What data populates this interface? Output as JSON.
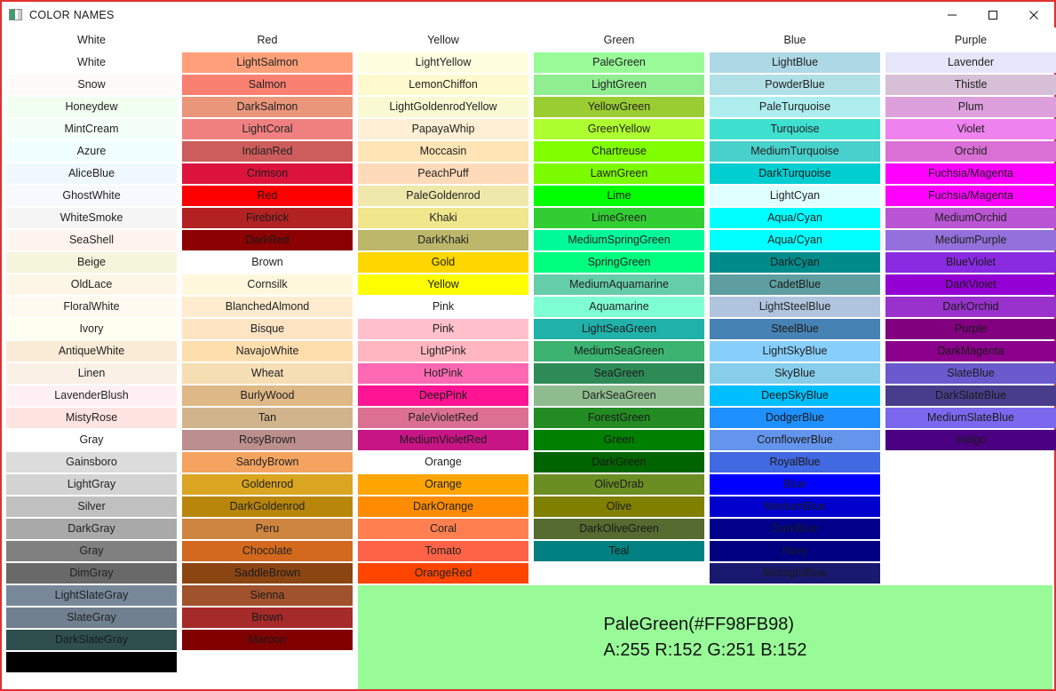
{
  "window": {
    "title": "COLOR NAMES",
    "icon": "app-color-icon",
    "border_color": "#e03030",
    "minimize_label": "—",
    "maximize_label": "□",
    "close_label": "✕"
  },
  "columns": [
    {
      "header": "White",
      "swatches": [
        {
          "name": "White",
          "bg": "#FFFFFF",
          "fg": "#222222"
        },
        {
          "name": "Snow",
          "bg": "#FFFAFA",
          "fg": "#222222"
        },
        {
          "name": "Honeydew",
          "bg": "#F0FFF0",
          "fg": "#222222"
        },
        {
          "name": "MintCream",
          "bg": "#F5FFFA",
          "fg": "#222222"
        },
        {
          "name": "Azure",
          "bg": "#F0FFFF",
          "fg": "#222222"
        },
        {
          "name": "AliceBlue",
          "bg": "#F0F8FF",
          "fg": "#222222"
        },
        {
          "name": "GhostWhite",
          "bg": "#F8F8FF",
          "fg": "#222222"
        },
        {
          "name": "WhiteSmoke",
          "bg": "#F5F5F5",
          "fg": "#222222"
        },
        {
          "name": "SeaShell",
          "bg": "#FFF5EE",
          "fg": "#222222"
        },
        {
          "name": "Beige",
          "bg": "#F5F5DC",
          "fg": "#222222"
        },
        {
          "name": "OldLace",
          "bg": "#FDF5E6",
          "fg": "#222222"
        },
        {
          "name": "FloralWhite",
          "bg": "#FFFAF0",
          "fg": "#222222"
        },
        {
          "name": "Ivory",
          "bg": "#FFFFF0",
          "fg": "#222222"
        },
        {
          "name": "AntiqueWhite",
          "bg": "#FAEBD7",
          "fg": "#222222"
        },
        {
          "name": "Linen",
          "bg": "#FAF0E6",
          "fg": "#222222"
        },
        {
          "name": "LavenderBlush",
          "bg": "#FFF0F5",
          "fg": "#222222"
        },
        {
          "name": "MistyRose",
          "bg": "#FFE4E1",
          "fg": "#222222"
        },
        {
          "name": "Gray",
          "bg": "#FFFFFF",
          "fg": "#222222",
          "group": true
        },
        {
          "name": "Gainsboro",
          "bg": "#DCDCDC",
          "fg": "#222222"
        },
        {
          "name": "LightGray",
          "bg": "#D3D3D3",
          "fg": "#222222"
        },
        {
          "name": "Silver",
          "bg": "#C0C0C0",
          "fg": "#222222"
        },
        {
          "name": "DarkGray",
          "bg": "#A9A9A9",
          "fg": "#222222"
        },
        {
          "name": "Gray",
          "bg": "#808080",
          "fg": "#222222"
        },
        {
          "name": "DimGray",
          "bg": "#696969",
          "fg": "#222222"
        },
        {
          "name": "LightSlateGray",
          "bg": "#778899",
          "fg": "#222222"
        },
        {
          "name": "SlateGray",
          "bg": "#708090",
          "fg": "#222222"
        },
        {
          "name": "DarkSlateGray",
          "bg": "#2F4F4F",
          "fg": "#1a1a1a"
        },
        {
          "name": "",
          "bg": "#000000",
          "fg": "#000000"
        }
      ]
    },
    {
      "header": "Red",
      "swatches": [
        {
          "name": "LightSalmon",
          "bg": "#FFA07A",
          "fg": "#222222"
        },
        {
          "name": "Salmon",
          "bg": "#FA8072",
          "fg": "#222222"
        },
        {
          "name": "DarkSalmon",
          "bg": "#E9967A",
          "fg": "#222222"
        },
        {
          "name": "LightCoral",
          "bg": "#F08080",
          "fg": "#222222"
        },
        {
          "name": "IndianRed",
          "bg": "#CD5C5C",
          "fg": "#222222"
        },
        {
          "name": "Crimson",
          "bg": "#DC143C",
          "fg": "#1a1a1a"
        },
        {
          "name": "Red",
          "bg": "#FF0000",
          "fg": "#1a1a1a"
        },
        {
          "name": "Firebrick",
          "bg": "#B22222",
          "fg": "#1a1a1a"
        },
        {
          "name": "DarkRed",
          "bg": "#8B0000",
          "fg": "#1a1a1a"
        },
        {
          "name": "Brown",
          "bg": "#FFFFFF",
          "fg": "#222222",
          "group": true
        },
        {
          "name": "Cornsilk",
          "bg": "#FFF8DC",
          "fg": "#222222"
        },
        {
          "name": "BlanchedAlmond",
          "bg": "#FFEBCD",
          "fg": "#222222"
        },
        {
          "name": "Bisque",
          "bg": "#FFE4C4",
          "fg": "#222222"
        },
        {
          "name": "NavajoWhite",
          "bg": "#FFDEAD",
          "fg": "#222222"
        },
        {
          "name": "Wheat",
          "bg": "#F5DEB3",
          "fg": "#222222"
        },
        {
          "name": "BurlyWood",
          "bg": "#DEB887",
          "fg": "#222222"
        },
        {
          "name": "Tan",
          "bg": "#D2B48C",
          "fg": "#222222"
        },
        {
          "name": "RosyBrown",
          "bg": "#BC8F8F",
          "fg": "#222222"
        },
        {
          "name": "SandyBrown",
          "bg": "#F4A460",
          "fg": "#222222"
        },
        {
          "name": "Goldenrod",
          "bg": "#DAA520",
          "fg": "#222222"
        },
        {
          "name": "DarkGoldenrod",
          "bg": "#B8860B",
          "fg": "#222222"
        },
        {
          "name": "Peru",
          "bg": "#CD853F",
          "fg": "#222222"
        },
        {
          "name": "Chocolate",
          "bg": "#D2691E",
          "fg": "#222222"
        },
        {
          "name": "SaddleBrown",
          "bg": "#8B4513",
          "fg": "#1a1a1a"
        },
        {
          "name": "Sienna",
          "bg": "#A0522D",
          "fg": "#1a1a1a"
        },
        {
          "name": "Brown",
          "bg": "#A52A2A",
          "fg": "#1a1a1a"
        },
        {
          "name": "Maroon",
          "bg": "#800000",
          "fg": "#1a1a1a"
        }
      ]
    },
    {
      "header": "Yellow",
      "swatches": [
        {
          "name": "LightYellow",
          "bg": "#FFFFE0",
          "fg": "#222222"
        },
        {
          "name": "LemonChiffon",
          "bg": "#FFFACD",
          "fg": "#222222"
        },
        {
          "name": "LightGoldenrodYellow",
          "bg": "#FAFAD2",
          "fg": "#222222"
        },
        {
          "name": "PapayaWhip",
          "bg": "#FFEFD5",
          "fg": "#222222"
        },
        {
          "name": "Moccasin",
          "bg": "#FFE4B5",
          "fg": "#222222"
        },
        {
          "name": "PeachPuff",
          "bg": "#FFDAB9",
          "fg": "#222222"
        },
        {
          "name": "PaleGoldenrod",
          "bg": "#EEE8AA",
          "fg": "#222222"
        },
        {
          "name": "Khaki",
          "bg": "#F0E68C",
          "fg": "#222222"
        },
        {
          "name": "DarkKhaki",
          "bg": "#BDB76B",
          "fg": "#222222"
        },
        {
          "name": "Gold",
          "bg": "#FFD700",
          "fg": "#222222"
        },
        {
          "name": "Yellow",
          "bg": "#FFFF00",
          "fg": "#222222"
        },
        {
          "name": "Pink",
          "bg": "#FFFFFF",
          "fg": "#222222",
          "group": true
        },
        {
          "name": "Pink",
          "bg": "#FFC0CB",
          "fg": "#222222"
        },
        {
          "name": "LightPink",
          "bg": "#FFB6C1",
          "fg": "#222222"
        },
        {
          "name": "HotPink",
          "bg": "#FF69B4",
          "fg": "#222222"
        },
        {
          "name": "DeepPink",
          "bg": "#FF1493",
          "fg": "#1a1a1a"
        },
        {
          "name": "PaleVioletRed",
          "bg": "#DB7093",
          "fg": "#222222"
        },
        {
          "name": "MediumVioletRed",
          "bg": "#C71585",
          "fg": "#1a1a1a"
        },
        {
          "name": "Orange",
          "bg": "#FFFFFF",
          "fg": "#222222",
          "group": true
        },
        {
          "name": "Orange",
          "bg": "#FFA500",
          "fg": "#222222"
        },
        {
          "name": "DarkOrange",
          "bg": "#FF8C00",
          "fg": "#222222"
        },
        {
          "name": "Coral",
          "bg": "#FF7F50",
          "fg": "#222222"
        },
        {
          "name": "Tomato",
          "bg": "#FF6347",
          "fg": "#222222"
        },
        {
          "name": "OrangeRed",
          "bg": "#FF4500",
          "fg": "#222222"
        }
      ]
    },
    {
      "header": "Green",
      "swatches": [
        {
          "name": "PaleGreen",
          "bg": "#98FB98",
          "fg": "#222222"
        },
        {
          "name": "LightGreen",
          "bg": "#90EE90",
          "fg": "#222222"
        },
        {
          "name": "YellowGreen",
          "bg": "#9ACD32",
          "fg": "#222222"
        },
        {
          "name": "GreenYellow",
          "bg": "#ADFF2F",
          "fg": "#222222"
        },
        {
          "name": "Chartreuse",
          "bg": "#7FFF00",
          "fg": "#222222"
        },
        {
          "name": "LawnGreen",
          "bg": "#7CFC00",
          "fg": "#222222"
        },
        {
          "name": "Lime",
          "bg": "#00FF00",
          "fg": "#222222"
        },
        {
          "name": "LimeGreen",
          "bg": "#32CD32",
          "fg": "#222222"
        },
        {
          "name": "MediumSpringGreen",
          "bg": "#00FA9A",
          "fg": "#222222"
        },
        {
          "name": "SpringGreen",
          "bg": "#00FF7F",
          "fg": "#222222"
        },
        {
          "name": "MediumAquamarine",
          "bg": "#66CDAA",
          "fg": "#222222"
        },
        {
          "name": "Aquamarine",
          "bg": "#7FFFD4",
          "fg": "#222222"
        },
        {
          "name": "LightSeaGreen",
          "bg": "#20B2AA",
          "fg": "#1a1a1a"
        },
        {
          "name": "MediumSeaGreen",
          "bg": "#3CB371",
          "fg": "#1a1a1a"
        },
        {
          "name": "SeaGreen",
          "bg": "#2E8B57",
          "fg": "#1a1a1a"
        },
        {
          "name": "DarkSeaGreen",
          "bg": "#8FBC8F",
          "fg": "#222222"
        },
        {
          "name": "ForestGreen",
          "bg": "#228B22",
          "fg": "#1a1a1a"
        },
        {
          "name": "Green",
          "bg": "#008000",
          "fg": "#1a1a1a"
        },
        {
          "name": "DarkGreen",
          "bg": "#006400",
          "fg": "#1a1a1a"
        },
        {
          "name": "OliveDrab",
          "bg": "#6B8E23",
          "fg": "#1a1a1a"
        },
        {
          "name": "Olive",
          "bg": "#808000",
          "fg": "#1a1a1a"
        },
        {
          "name": "DarkOliveGreen",
          "bg": "#556B2F",
          "fg": "#1a1a1a"
        },
        {
          "name": "Teal",
          "bg": "#008080",
          "fg": "#1a1a1a"
        }
      ]
    },
    {
      "header": "Blue",
      "swatches": [
        {
          "name": "LightBlue",
          "bg": "#ADD8E6",
          "fg": "#222222"
        },
        {
          "name": "PowderBlue",
          "bg": "#B0E0E6",
          "fg": "#222222"
        },
        {
          "name": "PaleTurquoise",
          "bg": "#AFEEEE",
          "fg": "#222222"
        },
        {
          "name": "Turquoise",
          "bg": "#40E0D0",
          "fg": "#222222"
        },
        {
          "name": "MediumTurquoise",
          "bg": "#48D1CC",
          "fg": "#222222"
        },
        {
          "name": "DarkTurquoise",
          "bg": "#00CED1",
          "fg": "#1a1a1a"
        },
        {
          "name": "LightCyan",
          "bg": "#E0FFFF",
          "fg": "#222222"
        },
        {
          "name": "Aqua/Cyan",
          "bg": "#00FFFF",
          "fg": "#222222"
        },
        {
          "name": "Aqua/Cyan",
          "bg": "#00FFFF",
          "fg": "#222222"
        },
        {
          "name": "DarkCyan",
          "bg": "#008B8B",
          "fg": "#1a1a1a"
        },
        {
          "name": "CadetBlue",
          "bg": "#5F9EA0",
          "fg": "#1a1a1a"
        },
        {
          "name": "LightSteelBlue",
          "bg": "#B0C4DE",
          "fg": "#222222"
        },
        {
          "name": "SteelBlue",
          "bg": "#4682B4",
          "fg": "#1a1a1a"
        },
        {
          "name": "LightSkyBlue",
          "bg": "#87CEFA",
          "fg": "#222222"
        },
        {
          "name": "SkyBlue",
          "bg": "#87CEEB",
          "fg": "#222222"
        },
        {
          "name": "DeepSkyBlue",
          "bg": "#00BFFF",
          "fg": "#1a1a1a"
        },
        {
          "name": "DodgerBlue",
          "bg": "#1E90FF",
          "fg": "#1a1a1a"
        },
        {
          "name": "CornflowerBlue",
          "bg": "#6495ED",
          "fg": "#1a1a1a"
        },
        {
          "name": "RoyalBlue",
          "bg": "#4169E1",
          "fg": "#1a1a1a"
        },
        {
          "name": "Blue",
          "bg": "#0000FF",
          "fg": "#1a1a1a"
        },
        {
          "name": "MediumBlue",
          "bg": "#0000CD",
          "fg": "#1a1a1a"
        },
        {
          "name": "DarkBlue",
          "bg": "#00008B",
          "fg": "#1a1a1a"
        },
        {
          "name": "Navy",
          "bg": "#000080",
          "fg": "#1a1a1a"
        },
        {
          "name": "MidnightBlue",
          "bg": "#191970",
          "fg": "#1a1a1a"
        }
      ]
    },
    {
      "header": "Purple",
      "swatches": [
        {
          "name": "Lavender",
          "bg": "#E6E6FA",
          "fg": "#222222"
        },
        {
          "name": "Thistle",
          "bg": "#D8BFD8",
          "fg": "#222222"
        },
        {
          "name": "Plum",
          "bg": "#DDA0DD",
          "fg": "#222222"
        },
        {
          "name": "Violet",
          "bg": "#EE82EE",
          "fg": "#222222"
        },
        {
          "name": "Orchid",
          "bg": "#DA70D6",
          "fg": "#222222"
        },
        {
          "name": "Fuchsia/Magenta",
          "bg": "#FF00FF",
          "fg": "#1a1a1a"
        },
        {
          "name": "Fuchsia/Magenta",
          "bg": "#FF00FF",
          "fg": "#1a1a1a"
        },
        {
          "name": "MediumOrchid",
          "bg": "#BA55D3",
          "fg": "#222222"
        },
        {
          "name": "MediumPurple",
          "bg": "#9370DB",
          "fg": "#222222"
        },
        {
          "name": "BlueViolet",
          "bg": "#8A2BE2",
          "fg": "#1a1a1a"
        },
        {
          "name": "DarkViolet",
          "bg": "#9400D3",
          "fg": "#1a1a1a"
        },
        {
          "name": "DarkOrchid",
          "bg": "#9932CC",
          "fg": "#1a1a1a"
        },
        {
          "name": "Purple",
          "bg": "#800080",
          "fg": "#1a1a1a"
        },
        {
          "name": "DarkMagenta",
          "bg": "#8B008B",
          "fg": "#1a1a1a"
        },
        {
          "name": "SlateBlue",
          "bg": "#6A5ACD",
          "fg": "#1a1a1a"
        },
        {
          "name": "DarkSlateBlue",
          "bg": "#483D8B",
          "fg": "#1a1a1a"
        },
        {
          "name": "MediumSlateBlue",
          "bg": "#7B68EE",
          "fg": "#1a1a1a"
        },
        {
          "name": "Indigo",
          "bg": "#4B0082",
          "fg": "#1a1a1a"
        }
      ]
    }
  ],
  "info_panel": {
    "background": "#98FB98",
    "name_line": "PaleGreen(#FF98FB98)",
    "argb_line": "A:255 R:152 G:251 B:152"
  }
}
